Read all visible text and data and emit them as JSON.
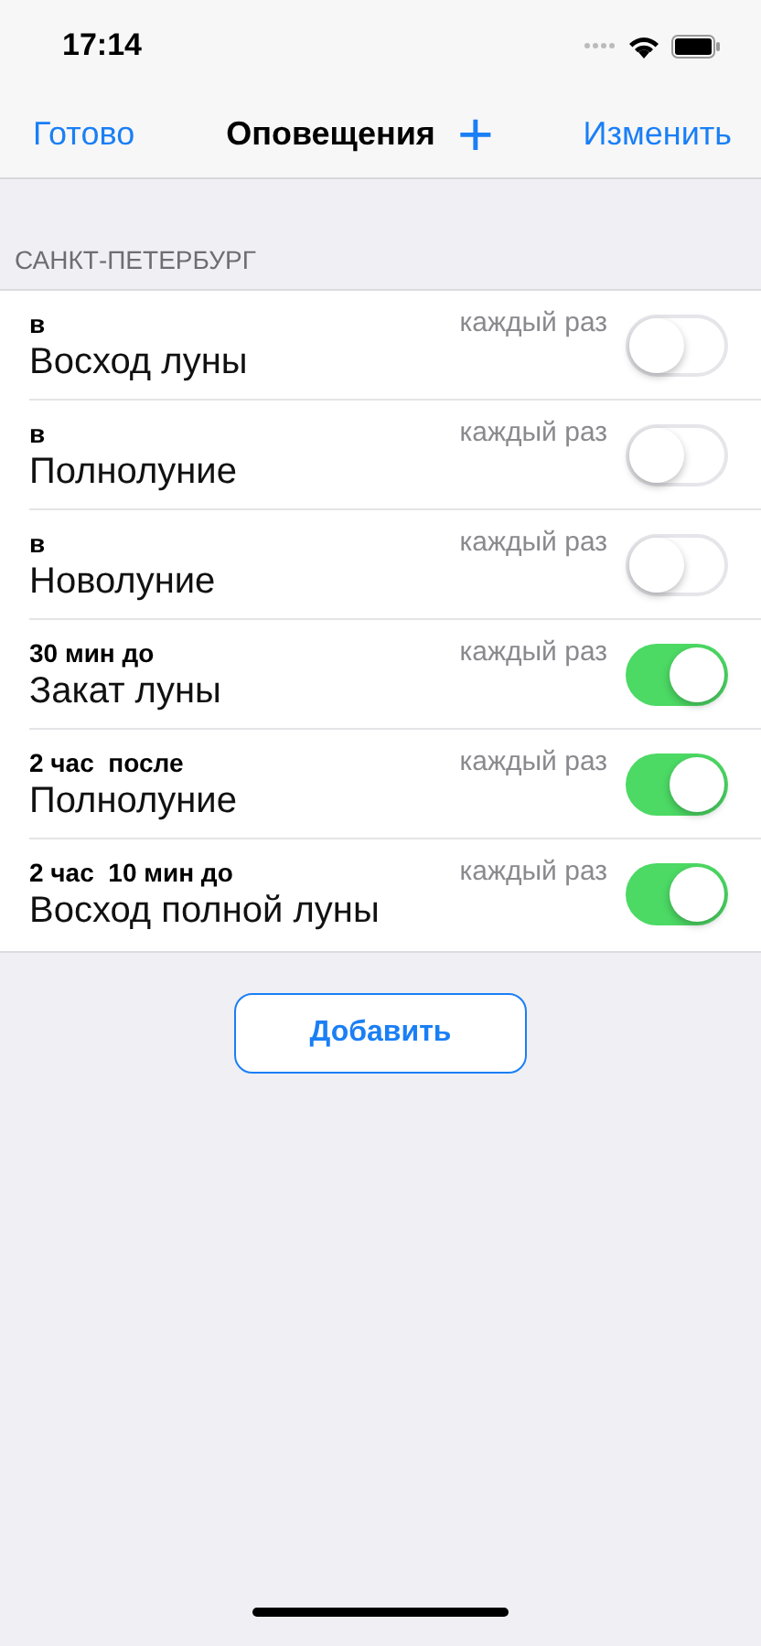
{
  "status_bar": {
    "time": "17:14"
  },
  "nav": {
    "left": "Готово",
    "title": "Оповещения",
    "add": "+",
    "right": "Изменить"
  },
  "section": {
    "header": "САНКТ-ПЕТЕРБУРГ",
    "rows": [
      {
        "when": "в",
        "event": "Восход луны",
        "repeat": "каждый раз",
        "on": false
      },
      {
        "when": "в",
        "event": "Полнолуние",
        "repeat": "каждый раз",
        "on": false
      },
      {
        "when": "в",
        "event": "Новолуние",
        "repeat": "каждый раз",
        "on": false
      },
      {
        "when": "30 мин до",
        "event": "Закат луны",
        "repeat": "каждый раз",
        "on": true
      },
      {
        "when": "2 час  после",
        "event": "Полнолуние",
        "repeat": "каждый раз",
        "on": true
      },
      {
        "when": "2 час  10 мин до",
        "event": "Восход полной луны",
        "repeat": "каждый раз",
        "on": true
      }
    ]
  },
  "add_button": "Добавить"
}
